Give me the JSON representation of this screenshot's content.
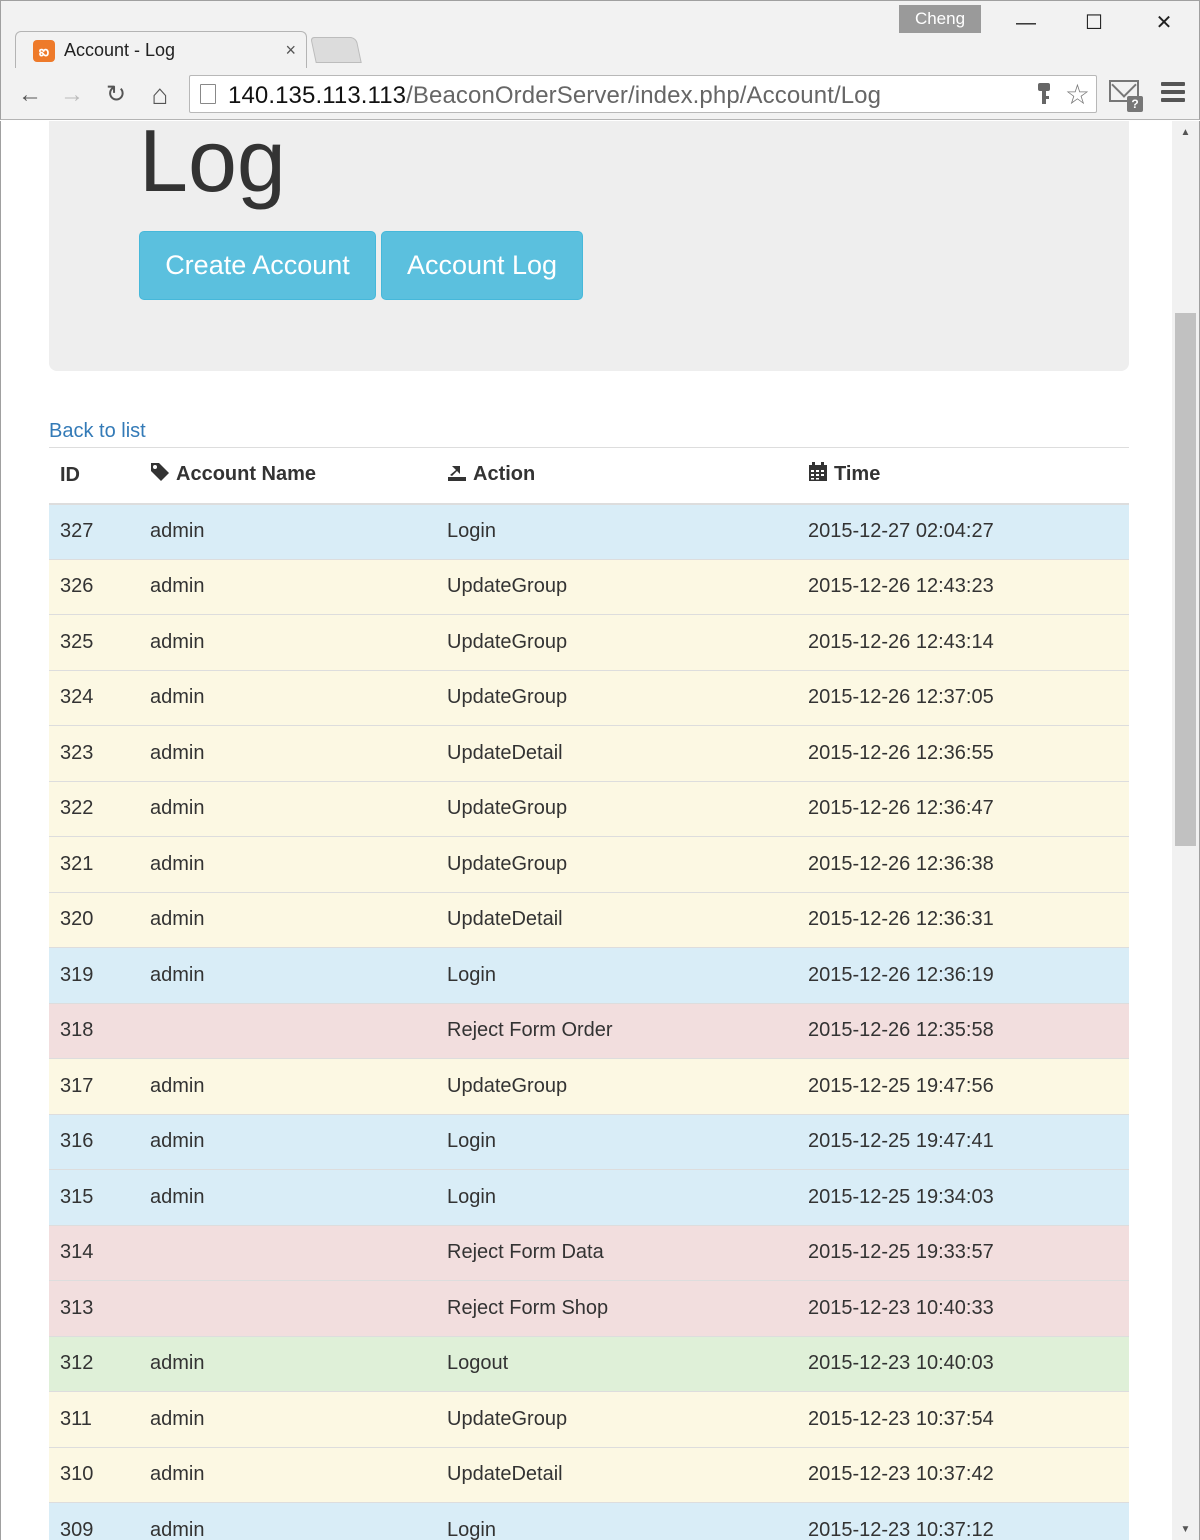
{
  "browser": {
    "tab_title": "Account - Log",
    "tab_close": "×",
    "profile_name": "Cheng",
    "url_host": "140.135.113.113",
    "url_path": "/BeaconOrderServer/index.php/Account/Log",
    "minimize": "—",
    "maximize": "☐",
    "close": "✕",
    "back": "←",
    "forward": "→",
    "reload": "↻",
    "home": "⌂",
    "star": "☆"
  },
  "page": {
    "title": "Log",
    "buttons": {
      "create_account": "Create Account",
      "account_log": "Account Log"
    },
    "back_link": "Back to list"
  },
  "table": {
    "headers": {
      "id": "ID",
      "account_name": "Account Name",
      "action": "Action",
      "time": "Time"
    },
    "rows": [
      {
        "id": "327",
        "account": "admin",
        "action": "Login",
        "time": "2015-12-27 02:04:27",
        "status": "info"
      },
      {
        "id": "326",
        "account": "admin",
        "action": "UpdateGroup",
        "time": "2015-12-26 12:43:23",
        "status": "warning"
      },
      {
        "id": "325",
        "account": "admin",
        "action": "UpdateGroup",
        "time": "2015-12-26 12:43:14",
        "status": "warning"
      },
      {
        "id": "324",
        "account": "admin",
        "action": "UpdateGroup",
        "time": "2015-12-26 12:37:05",
        "status": "warning"
      },
      {
        "id": "323",
        "account": "admin",
        "action": "UpdateDetail",
        "time": "2015-12-26 12:36:55",
        "status": "warning"
      },
      {
        "id": "322",
        "account": "admin",
        "action": "UpdateGroup",
        "time": "2015-12-26 12:36:47",
        "status": "warning"
      },
      {
        "id": "321",
        "account": "admin",
        "action": "UpdateGroup",
        "time": "2015-12-26 12:36:38",
        "status": "warning"
      },
      {
        "id": "320",
        "account": "admin",
        "action": "UpdateDetail",
        "time": "2015-12-26 12:36:31",
        "status": "warning"
      },
      {
        "id": "319",
        "account": "admin",
        "action": "Login",
        "time": "2015-12-26 12:36:19",
        "status": "info"
      },
      {
        "id": "318",
        "account": "",
        "action": "Reject Form Order",
        "time": "2015-12-26 12:35:58",
        "status": "danger"
      },
      {
        "id": "317",
        "account": "admin",
        "action": "UpdateGroup",
        "time": "2015-12-25 19:47:56",
        "status": "warning"
      },
      {
        "id": "316",
        "account": "admin",
        "action": "Login",
        "time": "2015-12-25 19:47:41",
        "status": "info"
      },
      {
        "id": "315",
        "account": "admin",
        "action": "Login",
        "time": "2015-12-25 19:34:03",
        "status": "info"
      },
      {
        "id": "314",
        "account": "",
        "action": "Reject Form Data",
        "time": "2015-12-25 19:33:57",
        "status": "danger"
      },
      {
        "id": "313",
        "account": "",
        "action": "Reject Form Shop",
        "time": "2015-12-23 10:40:33",
        "status": "danger"
      },
      {
        "id": "312",
        "account": "admin",
        "action": "Logout",
        "time": "2015-12-23 10:40:03",
        "status": "success"
      },
      {
        "id": "311",
        "account": "admin",
        "action": "UpdateGroup",
        "time": "2015-12-23 10:37:54",
        "status": "warning"
      },
      {
        "id": "310",
        "account": "admin",
        "action": "UpdateDetail",
        "time": "2015-12-23 10:37:42",
        "status": "warning"
      },
      {
        "id": "309",
        "account": "admin",
        "action": "Login",
        "time": "2015-12-23 10:37:12",
        "status": "info"
      }
    ]
  },
  "colors": {
    "info": "#d9edf7",
    "warning": "#fcf8e3",
    "danger": "#f2dede",
    "success": "#dff0d8",
    "button": "#5bc0de",
    "link": "#337ab7"
  }
}
